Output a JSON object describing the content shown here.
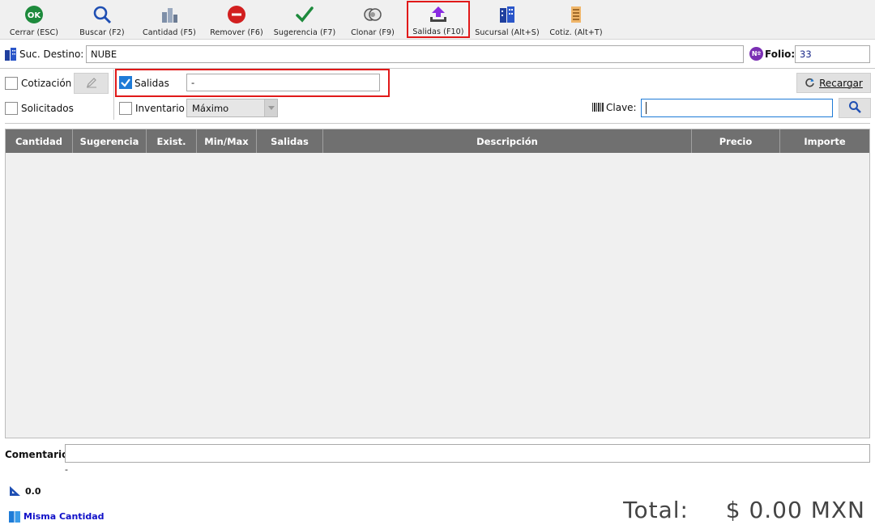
{
  "toolbar": {
    "cerrar": "Cerrar (ESC)",
    "cerrar_icon_text": "OK",
    "buscar": "Buscar (F2)",
    "cantidad": "Cantidad (F5)",
    "remover": "Remover (F6)",
    "sugerencia": "Sugerencia (F7)",
    "clonar": "Clonar (F9)",
    "salidas": "Salidas (F10)",
    "sucursal": "Sucursal (Alt+S)",
    "cotiz": "Cotiz. (Alt+T)"
  },
  "header": {
    "suc_destino_label": "Suc. Destino:",
    "suc_destino_value": "NUBE",
    "folio_badge": "Nº",
    "folio_label": "Folio:",
    "folio_value": "33"
  },
  "filters": {
    "cotizacion_label": "Cotización",
    "solicitados_label": "Solicitados",
    "salidas_label": "Salidas",
    "salidas_value": "-",
    "inventario_label": "Inventario",
    "inventario_selected": "Máximo",
    "recargar_label": "Recargar",
    "clave_label": "Clave:",
    "clave_value": ""
  },
  "table": {
    "columns": [
      "Cantidad",
      "Sugerencia",
      "Exist.",
      "Min/Max",
      "Salidas",
      "Descripción",
      "Precio",
      "Importe"
    ]
  },
  "footer": {
    "comentario_label": "Comentario:",
    "comentario_value": "",
    "dash": "-",
    "measure_value": "0.0",
    "misma_cantidad": "Misma Cantidad",
    "total_label": "Total:",
    "total_value": "$ 0.00 MXN"
  },
  "colors": {
    "accent_blue": "#1e7bd7",
    "highlight_red": "#e11919",
    "header_gray": "#707070",
    "link_blue": "#1010c8"
  }
}
